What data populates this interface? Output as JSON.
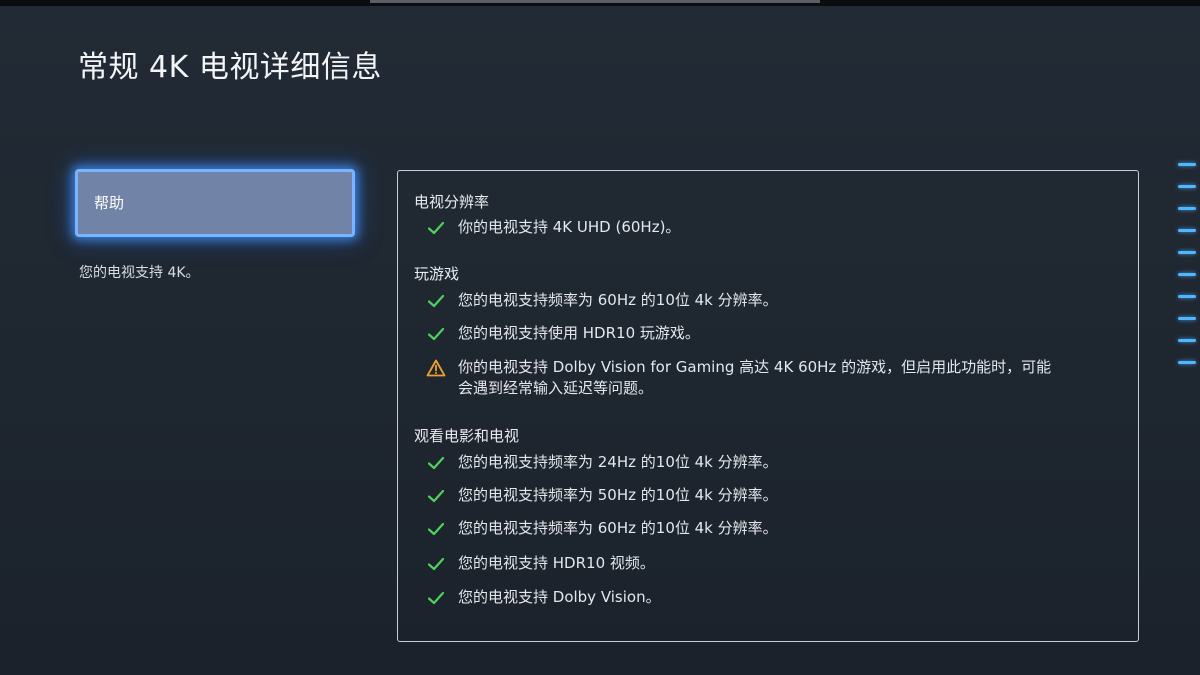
{
  "page": {
    "title": "常规 4K 电视详细信息"
  },
  "sidebar": {
    "help_label": "帮助",
    "description": "您的电视支持 4K。"
  },
  "details": {
    "resolution": {
      "title": "电视分辨率",
      "items": [
        {
          "status": "ok",
          "text": "你的电视支持 4K UHD (60Hz)。"
        }
      ]
    },
    "gaming": {
      "title": "玩游戏",
      "items": [
        {
          "status": "ok",
          "text": "您的电视支持频率为 60Hz 的10位 4k 分辨率。"
        },
        {
          "status": "ok",
          "text": "您的电视支持使用 HDR10 玩游戏。"
        },
        {
          "status": "warning",
          "text": "你的电视支持 Dolby Vision for Gaming 高达 4K 60Hz 的游戏，但启用此功能时，可能会遇到经常输入延迟等问题。"
        }
      ]
    },
    "movies": {
      "title": "观看电影和电视",
      "items": [
        {
          "status": "ok",
          "text": "您的电视支持频率为 24Hz 的10位 4k 分辨率。"
        },
        {
          "status": "ok",
          "text": "您的电视支持频率为 50Hz 的10位 4k 分辨率。"
        },
        {
          "status": "ok",
          "text": "您的电视支持频率为 60Hz 的10位 4k 分辨率。"
        },
        {
          "status": "ok",
          "text": "您的电视支持 HDR10 视频。"
        },
        {
          "status": "ok",
          "text": "您的电视支持 Dolby Vision。"
        }
      ]
    }
  },
  "icons": {
    "ok": "check-icon",
    "warning": "warning-icon"
  },
  "colors": {
    "ok": "#4fd15a",
    "warning": "#f0a030",
    "focus_glow": "#4a9cff",
    "background": "#212a34"
  }
}
